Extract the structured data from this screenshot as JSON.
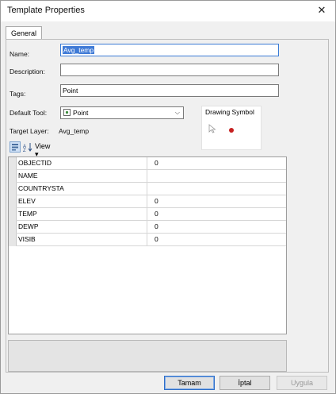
{
  "window": {
    "title": "Template Properties"
  },
  "tabs": [
    {
      "label": "General"
    }
  ],
  "form": {
    "name_label": "Name:",
    "name_value": "Avg_temp",
    "description_label": "Description:",
    "description_value": "",
    "tags_label": "Tags:",
    "tags_value": "Point",
    "default_tool_label": "Default Tool:",
    "default_tool_value": "Point",
    "target_layer_label": "Target Layer:",
    "target_layer_value": "Avg_temp",
    "drawing_symbol_label": "Drawing Symbol"
  },
  "toolbar": {
    "view_label": "View ▾"
  },
  "attributes": [
    {
      "name": "OBJECTID",
      "value": "0"
    },
    {
      "name": "NAME",
      "value": ""
    },
    {
      "name": "COUNTRYSTA",
      "value": ""
    },
    {
      "name": "ELEV",
      "value": "0"
    },
    {
      "name": "TEMP",
      "value": "0"
    },
    {
      "name": "DEWP",
      "value": "0"
    },
    {
      "name": "VISIB",
      "value": "0"
    }
  ],
  "buttons": {
    "ok": "Tamam",
    "cancel": "İptal",
    "apply": "Uygula"
  },
  "colors": {
    "selection": "#3f7ad6",
    "symbol": "#c62020",
    "dialog_bg": "#f0f0f0"
  }
}
